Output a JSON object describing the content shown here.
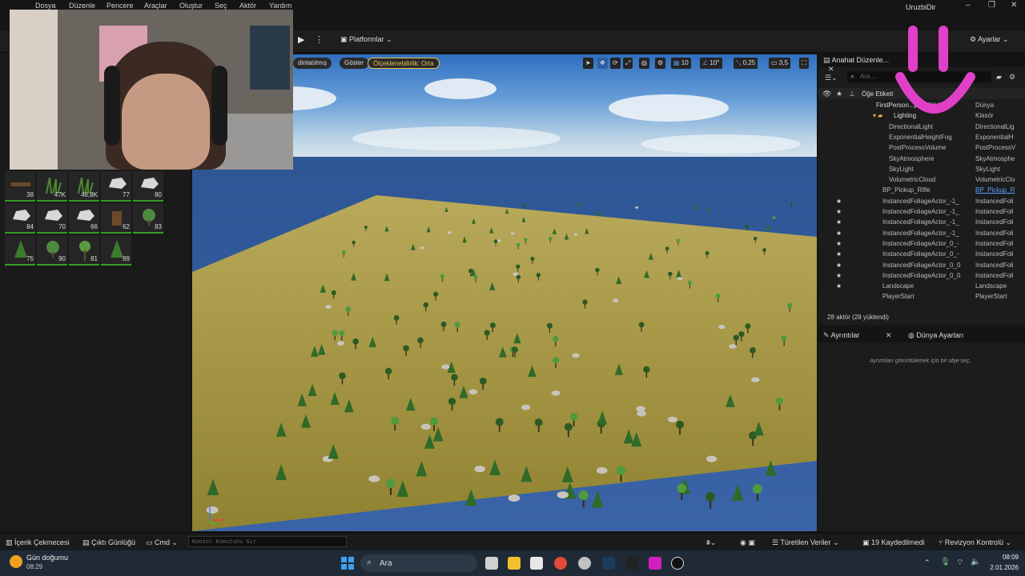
{
  "window": {
    "app_title": "UruzbiDir",
    "menu": [
      "Dosya",
      "Düzenle",
      "Pencere",
      "Araçlar",
      "Oluştur",
      "Seç",
      "Aktör",
      "Yardım"
    ]
  },
  "toolbar": {
    "platforms_label": "Platformlar",
    "settings_label": "Ayarlar"
  },
  "viewport": {
    "lit_label": "dinlatılmış",
    "show_label": "Göster",
    "scalability_label": "Ölçeklenebilirlik: Orta",
    "grid_snap": "10",
    "rotation_snap": "10°",
    "scale_snap": "0,25",
    "camera_speed": "3,5"
  },
  "foliage": {
    "tiles": [
      {
        "count": "38",
        "icon": "log-icon"
      },
      {
        "count": "47K",
        "icon": "grass-icon"
      },
      {
        "count": "46,8K",
        "icon": "grass-icon"
      },
      {
        "count": "77",
        "icon": "rock-icon"
      },
      {
        "count": "80",
        "icon": "rock-icon"
      },
      {
        "count": "84",
        "icon": "rock-icon"
      },
      {
        "count": "70",
        "icon": "rock-icon"
      },
      {
        "count": "66",
        "icon": "rock-icon"
      },
      {
        "count": "62",
        "icon": "stump-icon"
      },
      {
        "count": "83",
        "icon": "bush-icon"
      },
      {
        "count": "75",
        "icon": "pine-icon"
      },
      {
        "count": "90",
        "icon": "bush-icon"
      },
      {
        "count": "81",
        "icon": "tree-icon"
      },
      {
        "count": "89",
        "icon": "pine-icon"
      }
    ]
  },
  "outliner": {
    "tab_label": "Anahat Düzenle...",
    "search_placeholder": "Ara...",
    "column_label": "Öğe Etiketi",
    "rows": [
      {
        "name": "FirstPerson...p (Editör)",
        "type": "Dünya",
        "indent": 1,
        "star": false,
        "folder": false
      },
      {
        "name": "Lighting",
        "type": "Klasör",
        "indent": 2,
        "star": false,
        "folder": true
      },
      {
        "name": "DirectionalLight",
        "type": "DirectionalLig",
        "indent": 3,
        "star": false,
        "folder": false
      },
      {
        "name": "ExponentialHeightFog",
        "type": "ExponentialH",
        "indent": 3,
        "star": false,
        "folder": false
      },
      {
        "name": "PostProcessVolume",
        "type": "PostProcessV",
        "indent": 3,
        "star": false,
        "folder": false
      },
      {
        "name": "SkyAtmosphere",
        "type": "SkyAtmosphe",
        "indent": 3,
        "star": false,
        "folder": false
      },
      {
        "name": "SkyLight",
        "type": "SkyLight",
        "indent": 3,
        "star": false,
        "folder": false
      },
      {
        "name": "VolumetricCloud",
        "type": "VolumetricClo",
        "indent": 3,
        "star": false,
        "folder": false
      },
      {
        "name": "BP_Pickup_Rifle",
        "type": "BP_Pickup_R",
        "indent": 2,
        "star": false,
        "folder": false,
        "link": true
      },
      {
        "name": "InstancedFoliageActor_-1_",
        "type": "InstancedFoli",
        "indent": 2,
        "star": true,
        "folder": false
      },
      {
        "name": "InstancedFoliageActor_-1_",
        "type": "InstancedFoli",
        "indent": 2,
        "star": true,
        "folder": false
      },
      {
        "name": "InstancedFoliageActor_-1_",
        "type": "InstancedFoli",
        "indent": 2,
        "star": true,
        "folder": false
      },
      {
        "name": "InstancedFoliageActor_-1_",
        "type": "InstancedFoli",
        "indent": 2,
        "star": true,
        "folder": false
      },
      {
        "name": "InstancedFoliageActor_0_-",
        "type": "InstancedFoli",
        "indent": 2,
        "star": true,
        "folder": false
      },
      {
        "name": "InstancedFoliageActor_0_-",
        "type": "InstancedFoli",
        "indent": 2,
        "star": true,
        "folder": false
      },
      {
        "name": "InstancedFoliageActor_0_0",
        "type": "InstancedFoli",
        "indent": 2,
        "star": true,
        "folder": false
      },
      {
        "name": "InstancedFoliageActor_0_0",
        "type": "InstancedFoli",
        "indent": 2,
        "star": true,
        "folder": false
      },
      {
        "name": "Landscape",
        "type": "Landscape",
        "indent": 2,
        "star": true,
        "folder": false
      },
      {
        "name": "PlayerStart",
        "type": "PlayerStart",
        "indent": 2,
        "star": false,
        "folder": false
      }
    ],
    "actor_count": "28 aktör (28 yüklendi)"
  },
  "details": {
    "tab_label": "Ayrıntılar",
    "world_settings_label": "Dünya Ayarları",
    "empty_message": "Ayrıntıları görüntülemek için bir obje seç."
  },
  "bottombar": {
    "content_drawer": "İçerik Çekmecesi",
    "output_log": "Çıktı Günlüğü",
    "cmd": "Cmd",
    "console_placeholder": "Konsol Komutunu Gir",
    "derived_data": "Türetilen Veriler",
    "unsaved": "19 Kaydedilmedi",
    "revision_control": "Revizyon Kontrolü"
  },
  "taskbar": {
    "weather_title": "Gün doğumu",
    "weather_time": "08:29",
    "search_label": "Ara",
    "clock": "08:09",
    "date": "2.01.2026"
  },
  "colors": {
    "accent_pink": "#e040c8",
    "scalability_yellow": "#e8c24c",
    "foliage_green": "#3a9a2a"
  }
}
